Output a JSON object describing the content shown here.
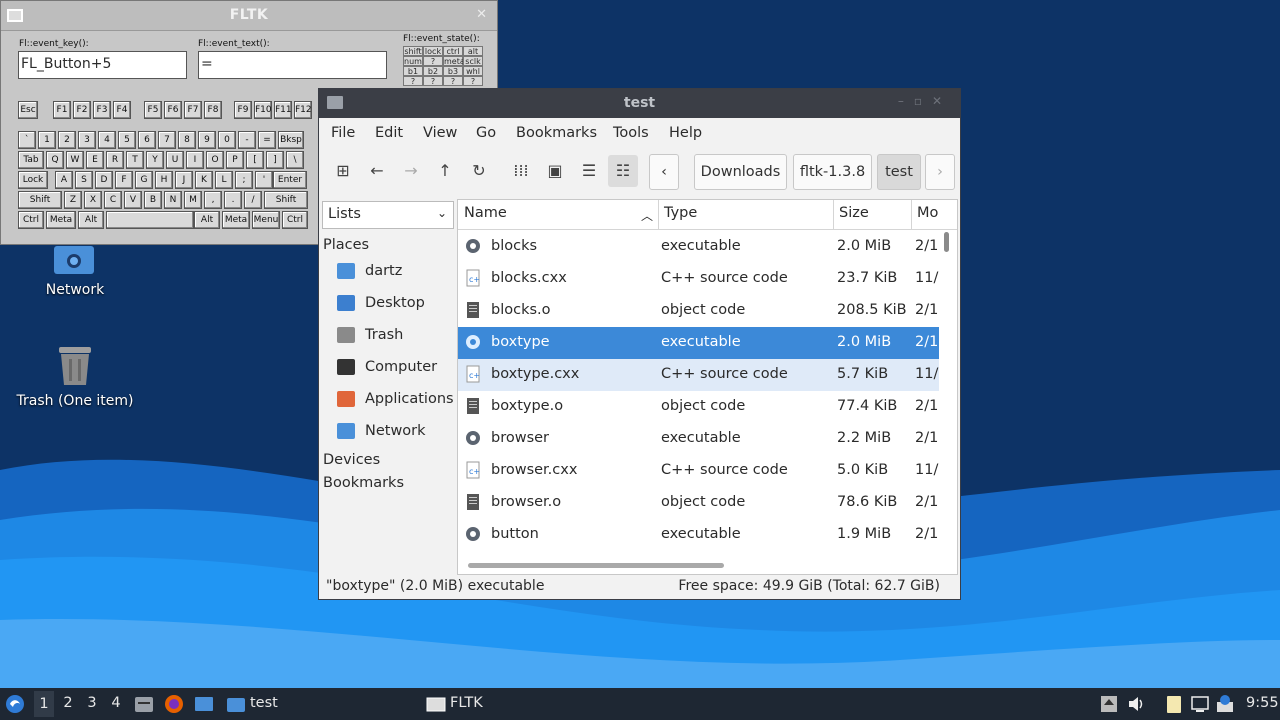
{
  "desktop": {
    "icons": [
      {
        "label": "Network",
        "icon": "network-folder-icon"
      },
      {
        "label": "Trash (One item)",
        "icon": "trash-icon"
      }
    ]
  },
  "fltk": {
    "title": "FLTK",
    "event_key_label": "Fl::event_key():",
    "event_key_value": "FL_Button+5",
    "event_text_label": "Fl::event_text():",
    "event_text_value": "=",
    "event_state_label": "Fl::event_state():",
    "state_cells": [
      "shift",
      "lock",
      "ctrl",
      "alt",
      "num",
      "?",
      "meta",
      "sclk",
      "b1",
      "b2",
      "b3",
      "whl",
      "?",
      "?",
      "?",
      "?"
    ],
    "keys": {
      "fn_row": [
        "Esc",
        "F1",
        "F2",
        "F3",
        "F4",
        "F5",
        "F6",
        "F7",
        "F8",
        "F9",
        "F10",
        "F11",
        "F12"
      ],
      "row1": [
        "`",
        "1",
        "2",
        "3",
        "4",
        "5",
        "6",
        "7",
        "8",
        "9",
        "0",
        "-",
        "=",
        "Bksp"
      ],
      "row2": [
        "Tab",
        "Q",
        "W",
        "E",
        "R",
        "T",
        "Y",
        "U",
        "I",
        "O",
        "P",
        "[",
        "]",
        "\\"
      ],
      "row3": [
        "Lock",
        "A",
        "S",
        "D",
        "F",
        "G",
        "H",
        "J",
        "K",
        "L",
        ";",
        "'",
        "Enter"
      ],
      "row4": [
        "Shift",
        "Z",
        "X",
        "C",
        "V",
        "B",
        "N",
        "M",
        ",",
        ".",
        "/",
        "Shift"
      ],
      "row5": [
        "Ctrl",
        "Meta",
        "Alt",
        "",
        "Alt",
        "Meta",
        "Menu",
        "Ctrl"
      ]
    }
  },
  "fm": {
    "title": "test",
    "menu": [
      "File",
      "Edit",
      "View",
      "Go",
      "Bookmarks",
      "Tools",
      "Help"
    ],
    "breadcrumbs": [
      "Downloads",
      "fltk-1.3.8",
      "test"
    ],
    "side_mode": "Lists",
    "places_header": "Places",
    "places": [
      {
        "label": "dartz",
        "color": "#4a90d9"
      },
      {
        "label": "Desktop",
        "color": "#3c7fcf"
      },
      {
        "label": "Trash",
        "color": "#8a8a8a"
      },
      {
        "label": "Computer",
        "color": "#333333"
      },
      {
        "label": "Applications",
        "color": "#e0663a"
      },
      {
        "label": "Network",
        "color": "#4a90d9"
      }
    ],
    "devices_header": "Devices",
    "bookmarks_header": "Bookmarks",
    "columns": [
      "Name",
      "Type",
      "Size",
      "Mo"
    ],
    "rows": [
      {
        "name": "blocks",
        "type": "executable",
        "size": "2.0 MiB",
        "mod": "2/1",
        "kind": "exec"
      },
      {
        "name": "blocks.cxx",
        "type": "C++ source code",
        "size": "23.7 KiB",
        "mod": "11/",
        "kind": "cxx"
      },
      {
        "name": "blocks.o",
        "type": "object code",
        "size": "208.5 KiB",
        "mod": "2/1",
        "kind": "obj"
      },
      {
        "name": "boxtype",
        "type": "executable",
        "size": "2.0 MiB",
        "mod": "2/1",
        "kind": "exec"
      },
      {
        "name": "boxtype.cxx",
        "type": "C++ source code",
        "size": "5.7 KiB",
        "mod": "11/",
        "kind": "cxx"
      },
      {
        "name": "boxtype.o",
        "type": "object code",
        "size": "77.4 KiB",
        "mod": "2/1",
        "kind": "obj"
      },
      {
        "name": "browser",
        "type": "executable",
        "size": "2.2 MiB",
        "mod": "2/1",
        "kind": "exec"
      },
      {
        "name": "browser.cxx",
        "type": "C++ source code",
        "size": "5.0 KiB",
        "mod": "11/",
        "kind": "cxx"
      },
      {
        "name": "browser.o",
        "type": "object code",
        "size": "78.6 KiB",
        "mod": "2/1",
        "kind": "obj"
      },
      {
        "name": "button",
        "type": "executable",
        "size": "1.9 MiB",
        "mod": "2/1",
        "kind": "exec"
      }
    ],
    "selected_index": 3,
    "hover_index": 4,
    "status_left": "\"boxtype\" (2.0 MiB) executable",
    "status_right": "Free space: 49.9 GiB (Total: 62.7 GiB)"
  },
  "taskbar": {
    "workspaces": [
      "1",
      "2",
      "3",
      "4"
    ],
    "active_workspace": "1",
    "windows": [
      "test",
      "FLTK"
    ],
    "clock": "9:55"
  },
  "colors": {
    "selection": "#3c89d8",
    "taskbar": "#1e2733",
    "desktop": "#0d3366"
  }
}
